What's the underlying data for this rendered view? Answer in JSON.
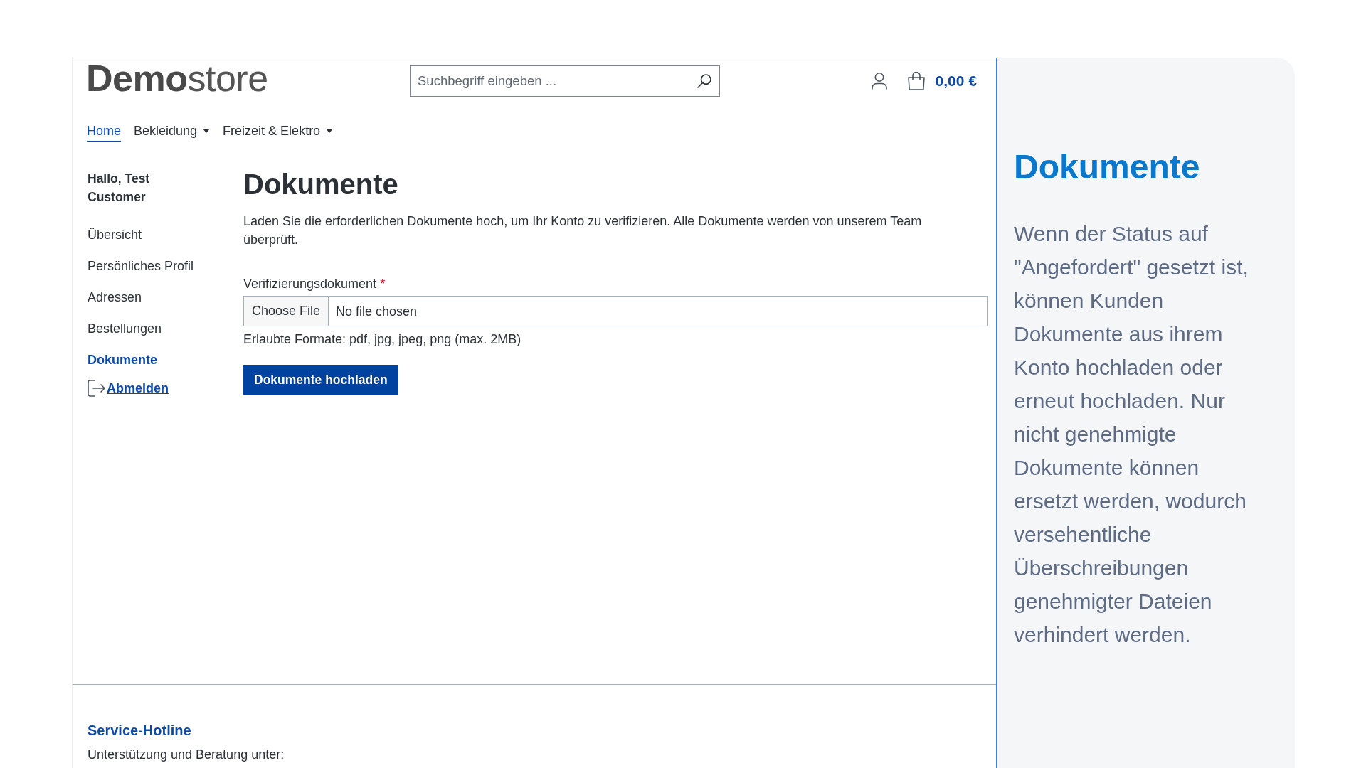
{
  "header": {
    "logo": {
      "bold": "Demo",
      "regular": "store"
    },
    "search": {
      "placeholder": "Suchbegriff eingeben ..."
    },
    "cart_total": "0,00 €"
  },
  "nav": [
    {
      "label": "Home",
      "selected": true,
      "dropdown": false
    },
    {
      "label": "Bekleidung",
      "selected": false,
      "dropdown": true
    },
    {
      "label": "Freizeit & Elektro",
      "selected": false,
      "dropdown": true
    }
  ],
  "sidebar": {
    "greeting": "Hallo, Test Customer",
    "items": [
      {
        "label": "Übersicht",
        "selected": false
      },
      {
        "label": "Persönliches Profil",
        "selected": false
      },
      {
        "label": "Adressen",
        "selected": false
      },
      {
        "label": "Bestellungen",
        "selected": false
      },
      {
        "label": "Dokumente",
        "selected": true
      }
    ],
    "logout": "Abmelden"
  },
  "main": {
    "title": "Dokumente",
    "description": "Laden Sie die erforderlichen Dokumente hoch, um Ihr Konto zu verifizieren. Alle Dokumente werden von unserem Team überprüft.",
    "upload": {
      "label": "Verifizierungsdokument",
      "required_mark": "*",
      "button": "Choose File",
      "value": "No file chosen",
      "hint": "Erlaubte Formate: pdf, jpg, jpeg, png (max. 2MB)"
    },
    "submit": "Dokumente hochladen"
  },
  "footer": {
    "title": "Service-Hotline",
    "text": "Unterstützung und Beratung unter:"
  },
  "info_panel": {
    "title": "Dokumente",
    "text": "Wenn der Status auf \"Angefordert\" gesetzt ist, können Kunden Dokumente aus ihrem Konto hochladen oder erneut hochladen. Nur nicht genehmigte Dokumente können ersetzt werden, wodurch versehentliche Überschreibungen genehmigter Dateien verhindert werden."
  }
}
